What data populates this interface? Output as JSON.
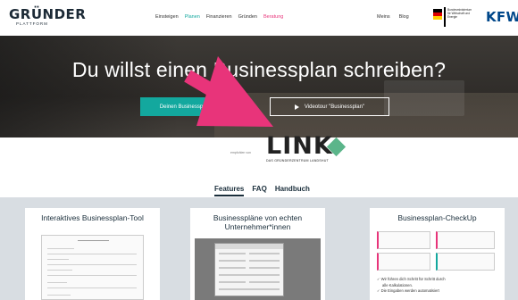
{
  "header": {
    "logo_main": "GRÜNDER",
    "logo_sub": "PLATTFORM",
    "nav": [
      "Einsteigen",
      "Planen",
      "Finanzieren",
      "Gründen",
      "Beratung"
    ],
    "side_nav": [
      "Meins",
      "Blog"
    ],
    "bmwi_text": "Bundesministerium für Wirtschaft und Energie",
    "kfw": "KFW"
  },
  "hero": {
    "title": "Du willst einen Businessplan schreiben?",
    "button_primary": "Deinen Businessplan",
    "button_video": "Videotour \"Businessplan\""
  },
  "sponsor": {
    "label": "empfohlen von",
    "logo_word": "LINK",
    "logo_sub": "DAS GRÜNDERZENTRUM LANDSHUT"
  },
  "tabs": [
    "Features",
    "FAQ",
    "Handbuch"
  ],
  "cards": [
    {
      "title": "Interaktives Businessplan-Tool"
    },
    {
      "title": "Businesspläne von echten Unternehmer*innen"
    },
    {
      "title": "Businessplan-CheckUp",
      "checks": [
        "✓ Wir führen dich Schritt für Schritt durch",
        "alle Kalkulationen.",
        "✓ Die Eingaben werden automatisiert"
      ]
    }
  ],
  "colors": {
    "accent": "#13a89e",
    "pink": "#e8347a",
    "kfw": "#00478a"
  }
}
